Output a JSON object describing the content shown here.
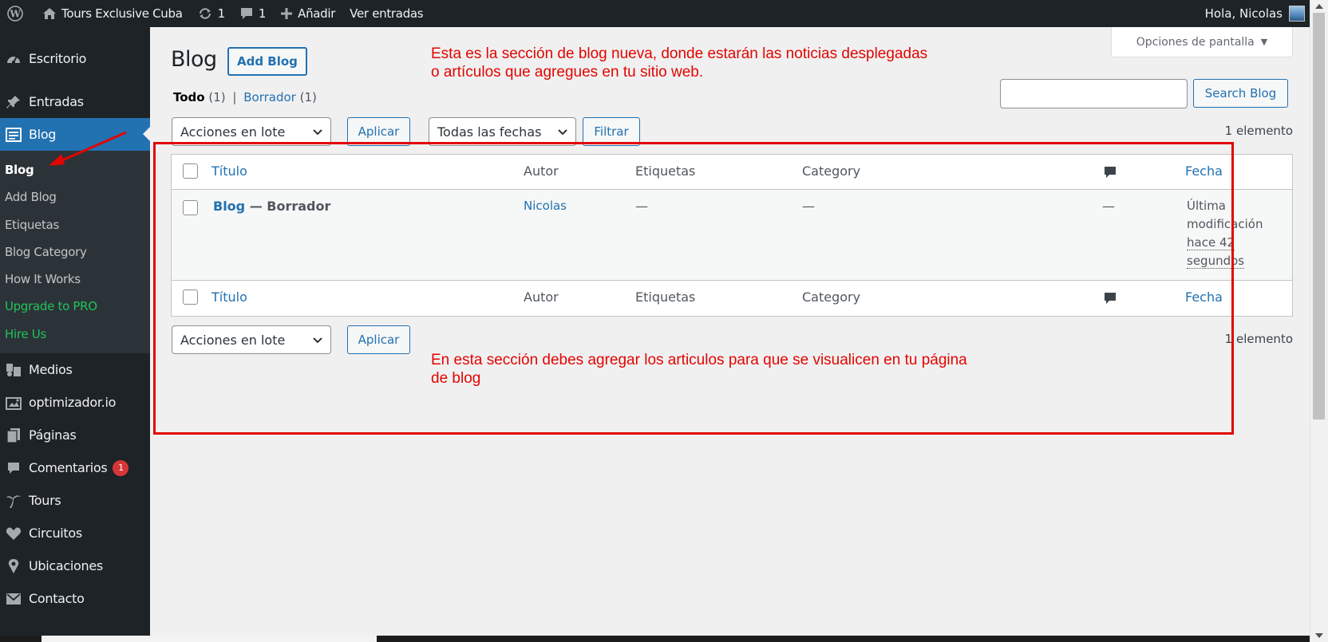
{
  "adminbar": {
    "site_name": "Tours Exclusive Cuba",
    "updates_count": "1",
    "comments_count": "1",
    "add_new": "Añadir",
    "view_posts": "Ver entradas",
    "greeting": "Hola, Nicolas"
  },
  "sidebar": {
    "items": [
      {
        "label": "Escritorio",
        "icon": "dashboard-icon"
      },
      {
        "label": "Entradas",
        "icon": "pin-icon"
      },
      {
        "label": "Blog",
        "icon": "blog-icon"
      },
      {
        "label": "Medios",
        "icon": "media-icon"
      },
      {
        "label": "optimizador.io",
        "icon": "image-icon"
      },
      {
        "label": "Páginas",
        "icon": "pages-icon"
      },
      {
        "label": "Comentarios",
        "icon": "comments-icon",
        "badge": "1"
      },
      {
        "label": "Tours",
        "icon": "palm-icon"
      },
      {
        "label": "Circuitos",
        "icon": "heart-icon"
      },
      {
        "label": "Ubicaciones",
        "icon": "location-icon"
      },
      {
        "label": "Contacto",
        "icon": "mail-icon"
      }
    ],
    "submenu": [
      "Blog",
      "Add Blog",
      "Etiquetas",
      "Blog Category",
      "How It Works",
      "Upgrade to PRO",
      "Hire Us"
    ]
  },
  "main": {
    "screen_options": "Opciones de pantalla",
    "title": "Blog",
    "add_button": "Add Blog",
    "note_top": [
      "Esta es la sección de blog nueva, donde estarán las noticias desplegadas",
      "o artículos que agregues en tu sitio web."
    ],
    "note_bottom": [
      "En esta sección debes agregar los articulos para que se visualicen en tu página",
      "de blog"
    ],
    "filters": {
      "all": "Todo",
      "all_count": "(1)",
      "sep": "|",
      "draft": "Borrador",
      "draft_count": "(1)"
    },
    "search_button": "Search Blog",
    "bulk_actions": "Acciones en lote",
    "apply": "Aplicar",
    "all_dates": "Todas las fechas",
    "filter": "Filtrar",
    "items_count": "1 elemento",
    "columns": {
      "title": "Título",
      "author": "Autor",
      "tags": "Etiquetas",
      "category": "Category",
      "date": "Fecha"
    },
    "row": {
      "title": "Blog",
      "state": "— Borrador",
      "author": "Nicolas",
      "tags": "—",
      "category": "—",
      "comments": "—",
      "date_line1": "Última",
      "date_line2": "modificación",
      "date_line3": "hace 42",
      "date_line4": "segundos"
    }
  },
  "colors": {
    "accent": "#2271b1",
    "annotation": "#e10600",
    "menu_bg": "#1d2327",
    "upgrade": "#1fc35a"
  }
}
